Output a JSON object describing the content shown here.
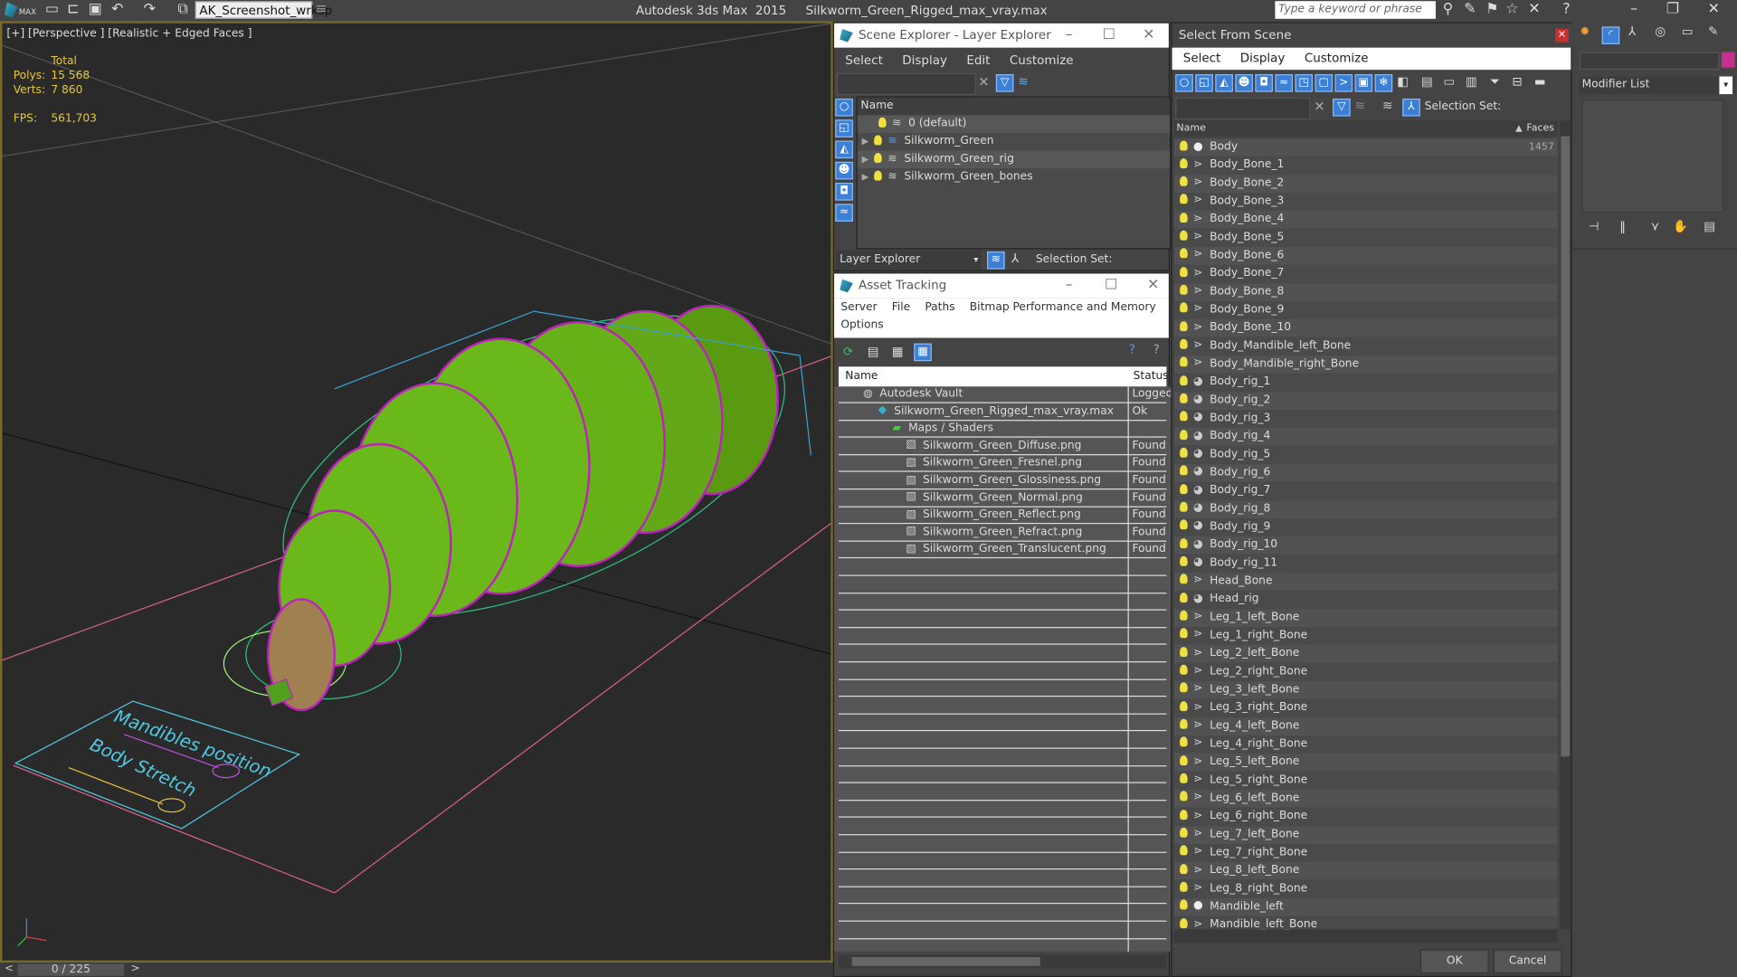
{
  "app": {
    "logo_label": "MAX",
    "workspace": "AK_Screenshot_wrksp",
    "title": "Autodesk 3ds Max  2015     Silkworm_Green_Rigged_max_vray.max",
    "search_placeholder": "Type a keyword or phrase"
  },
  "toolbar_icons": [
    "new-file-icon",
    "open-file-icon",
    "save-icon",
    "undo-icon",
    "redo-icon",
    "project-folder-icon"
  ],
  "viewport": {
    "label": "[+] [Perspective ] [Realistic + Edged Faces ]",
    "stats_header": "Total",
    "polys_label": "Polys:",
    "polys_value": "15 568",
    "verts_label": "Verts:",
    "verts_value": "7 860",
    "fps_label": "FPS:",
    "fps_value": "561,703",
    "annotation_1": "Mandibles position",
    "annotation_2": "Body Stretch"
  },
  "timeline": {
    "prev": "<",
    "frame": "0 / 225",
    "next": ">"
  },
  "scene_explorer": {
    "title": "Scene Explorer - Layer Explorer",
    "menu": [
      "Select",
      "Display",
      "Edit",
      "Customize"
    ],
    "column": "Name",
    "layers": [
      {
        "name": "0 (default)",
        "expandable": false
      },
      {
        "name": "Silkworm_Green",
        "expandable": true
      },
      {
        "name": "Silkworm_Green_rig",
        "expandable": true
      },
      {
        "name": "Silkworm_Green_bones",
        "expandable": true
      }
    ],
    "footer_dropdown": "Layer Explorer",
    "selection_set_label": "Selection Set:"
  },
  "asset_tracking": {
    "title": "Asset Tracking",
    "menu": [
      "Server",
      "File",
      "Paths",
      "Bitmap Performance and Memory"
    ],
    "menu2": [
      "Options"
    ],
    "columns": {
      "name": "Name",
      "status": "Status"
    },
    "rows": [
      {
        "name": "Autodesk Vault",
        "status": "Logged",
        "indent": 1,
        "icon": "vault-icon"
      },
      {
        "name": "Silkworm_Green_Rigged_max_vray.max",
        "status": "Ok",
        "indent": 2,
        "icon": "max-file-icon"
      },
      {
        "name": "Maps / Shaders",
        "status": "",
        "indent": 3,
        "icon": "maps-icon"
      },
      {
        "name": "Silkworm_Green_Diffuse.png",
        "status": "Found",
        "indent": 4,
        "icon": "bitmap-icon"
      },
      {
        "name": "Silkworm_Green_Fresnel.png",
        "status": "Found",
        "indent": 4,
        "icon": "bitmap-icon"
      },
      {
        "name": "Silkworm_Green_Glossiness.png",
        "status": "Found",
        "indent": 4,
        "icon": "bitmap-icon"
      },
      {
        "name": "Silkworm_Green_Normal.png",
        "status": "Found",
        "indent": 4,
        "icon": "bitmap-icon"
      },
      {
        "name": "Silkworm_Green_Reflect.png",
        "status": "Found",
        "indent": 4,
        "icon": "bitmap-icon"
      },
      {
        "name": "Silkworm_Green_Refract.png",
        "status": "Found",
        "indent": 4,
        "icon": "bitmap-icon"
      },
      {
        "name": "Silkworm_Green_Translucent.png",
        "status": "Found",
        "indent": 4,
        "icon": "bitmap-icon"
      }
    ]
  },
  "select_from_scene": {
    "title": "Select From Scene",
    "menu": [
      "Select",
      "Display",
      "Customize"
    ],
    "selection_set_label": "Selection Set:",
    "columns": {
      "name": "Name",
      "faces": "Faces"
    },
    "first_faces": "1457",
    "objects": [
      {
        "name": "Body",
        "type": "geometry"
      },
      {
        "name": "Body_Bone_1",
        "type": "bone"
      },
      {
        "name": "Body_Bone_2",
        "type": "bone"
      },
      {
        "name": "Body_Bone_3",
        "type": "bone"
      },
      {
        "name": "Body_Bone_4",
        "type": "bone"
      },
      {
        "name": "Body_Bone_5",
        "type": "bone"
      },
      {
        "name": "Body_Bone_6",
        "type": "bone"
      },
      {
        "name": "Body_Bone_7",
        "type": "bone"
      },
      {
        "name": "Body_Bone_8",
        "type": "bone"
      },
      {
        "name": "Body_Bone_9",
        "type": "bone"
      },
      {
        "name": "Body_Bone_10",
        "type": "bone"
      },
      {
        "name": "Body_Mandible_left_Bone",
        "type": "bone"
      },
      {
        "name": "Body_Mandible_right_Bone",
        "type": "bone"
      },
      {
        "name": "Body_rig_1",
        "type": "shape"
      },
      {
        "name": "Body_rig_2",
        "type": "shape"
      },
      {
        "name": "Body_rig_3",
        "type": "shape"
      },
      {
        "name": "Body_rig_4",
        "type": "shape"
      },
      {
        "name": "Body_rig_5",
        "type": "shape"
      },
      {
        "name": "Body_rig_6",
        "type": "shape"
      },
      {
        "name": "Body_rig_7",
        "type": "shape"
      },
      {
        "name": "Body_rig_8",
        "type": "shape"
      },
      {
        "name": "Body_rig_9",
        "type": "shape"
      },
      {
        "name": "Body_rig_10",
        "type": "shape"
      },
      {
        "name": "Body_rig_11",
        "type": "shape"
      },
      {
        "name": "Head_Bone",
        "type": "bone"
      },
      {
        "name": "Head_rig",
        "type": "shape"
      },
      {
        "name": "Leg_1_left_Bone",
        "type": "bone"
      },
      {
        "name": "Leg_1_right_Bone",
        "type": "bone"
      },
      {
        "name": "Leg_2_left_Bone",
        "type": "bone"
      },
      {
        "name": "Leg_2_right_Bone",
        "type": "bone"
      },
      {
        "name": "Leg_3_left_Bone",
        "type": "bone"
      },
      {
        "name": "Leg_3_right_Bone",
        "type": "bone"
      },
      {
        "name": "Leg_4_left_Bone",
        "type": "bone"
      },
      {
        "name": "Leg_4_right_Bone",
        "type": "bone"
      },
      {
        "name": "Leg_5_left_Bone",
        "type": "bone"
      },
      {
        "name": "Leg_5_right_Bone",
        "type": "bone"
      },
      {
        "name": "Leg_6_left_Bone",
        "type": "bone"
      },
      {
        "name": "Leg_6_right_Bone",
        "type": "bone"
      },
      {
        "name": "Leg_7_left_Bone",
        "type": "bone"
      },
      {
        "name": "Leg_7_right_Bone",
        "type": "bone"
      },
      {
        "name": "Leg_8_left_Bone",
        "type": "bone"
      },
      {
        "name": "Leg_8_right_Bone",
        "type": "bone"
      },
      {
        "name": "Mandible_left",
        "type": "geometry"
      },
      {
        "name": "Mandible_left_Bone",
        "type": "bone"
      }
    ],
    "ok_label": "OK",
    "cancel_label": "Cancel"
  },
  "command_panel": {
    "modifier_list": "Modifier List"
  },
  "colors": {
    "accent_blue": "#3b7fd6",
    "stat_yellow": "#e8c83a",
    "viewport_border": "#7a6a2a"
  }
}
